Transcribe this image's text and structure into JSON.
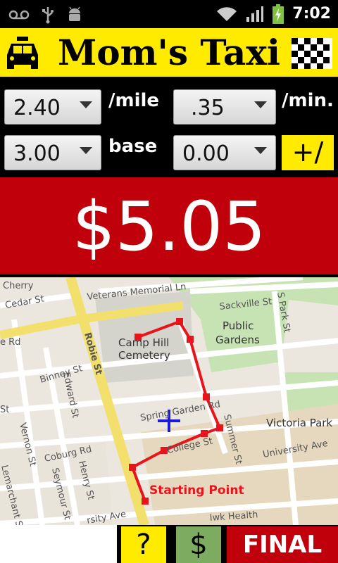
{
  "status_bar": {
    "time": "7:02",
    "icons": [
      "voicemail-icon",
      "usb-icon",
      "android-debug-icon",
      "wifi-icon",
      "signal-icon",
      "battery-charging-icon"
    ]
  },
  "header": {
    "title": "Mom's Taxi",
    "logo_icon": "taxi-icon",
    "flag_icon": "checkered-flag-icon"
  },
  "rates": {
    "per_mile": {
      "value": "2.40",
      "label": "/mile"
    },
    "per_min": {
      "value": ".35",
      "label": "/min."
    },
    "base": {
      "value": "3.00",
      "label": "base"
    },
    "adjust": {
      "value": "0.00"
    },
    "adjust_button": "+/−"
  },
  "fare": {
    "amount": "$5.05"
  },
  "map": {
    "labels": {
      "cherry": "Cherry",
      "cedar": "Cedar St",
      "veterans": "Veterans Memorial Ln",
      "sackville": "Sackville St",
      "park": "S Park St",
      "public_gardens": "Public",
      "public_gardens_2": "Gardens",
      "camp_hill": "Camp Hill",
      "cemetery": "Cemetery",
      "robie": "Robie St",
      "rd": "e Rd",
      "binney": "Binney St",
      "edward": "Edward St",
      "spring_garden": "Spring Garden Rd",
      "summer": "Summer St",
      "victoria_park": "Victoria Park",
      "university": "University Ave",
      "vernon": "Vernon St",
      "coburg": "Coburg Rd",
      "college": "College St",
      "lemarchant": "Lemarchant St",
      "seymour": "Seymour St",
      "henry": "Henry St",
      "st_left": "St",
      "university_2": "rsity Ave",
      "iwk": "Iwk Health",
      "starting_point": "Starting Point"
    },
    "route_color": "#e8141c",
    "marker_color": "#1a1adb"
  },
  "bottom": {
    "help_label": "?",
    "pay_label": "$",
    "final_label": "FINAL"
  },
  "colors": {
    "yellow": "#ffeb00",
    "red": "#c0000b",
    "green": "#7dab5f"
  }
}
